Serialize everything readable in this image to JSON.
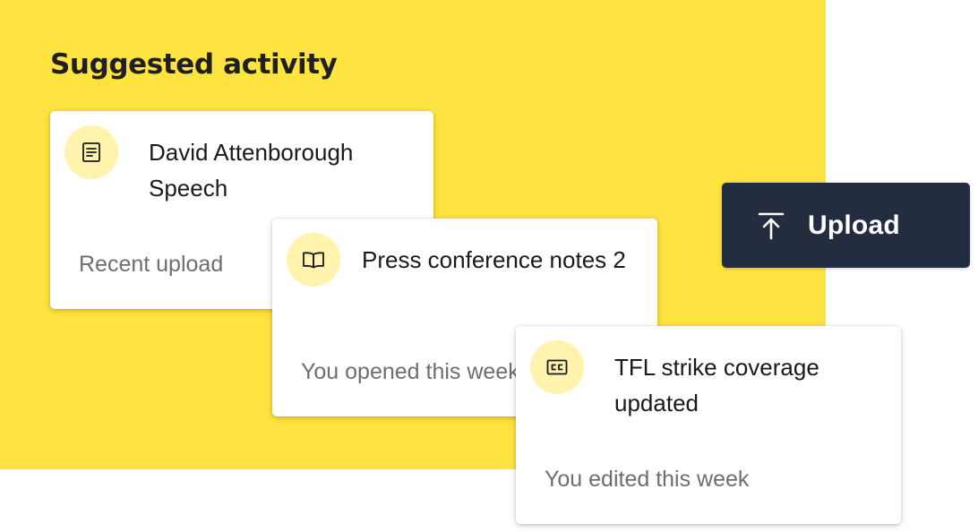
{
  "colors": {
    "accent": "#FFE340",
    "icon_bg": "#FFF3AE",
    "button_bg": "#232D3F",
    "meta_text": "#6B6F73"
  },
  "section": {
    "title": "Suggested activity"
  },
  "cards": [
    {
      "icon": "document-icon",
      "title": "David Attenborough Speech",
      "meta": "Recent upload"
    },
    {
      "icon": "open-book-icon",
      "title": "Press conference notes 2",
      "meta": "You opened this week"
    },
    {
      "icon": "closed-captions-icon",
      "title": "TFL strike coverage updated",
      "meta": "You edited this week"
    }
  ],
  "upload": {
    "icon": "upload-arrow-icon",
    "label": "Upload"
  }
}
